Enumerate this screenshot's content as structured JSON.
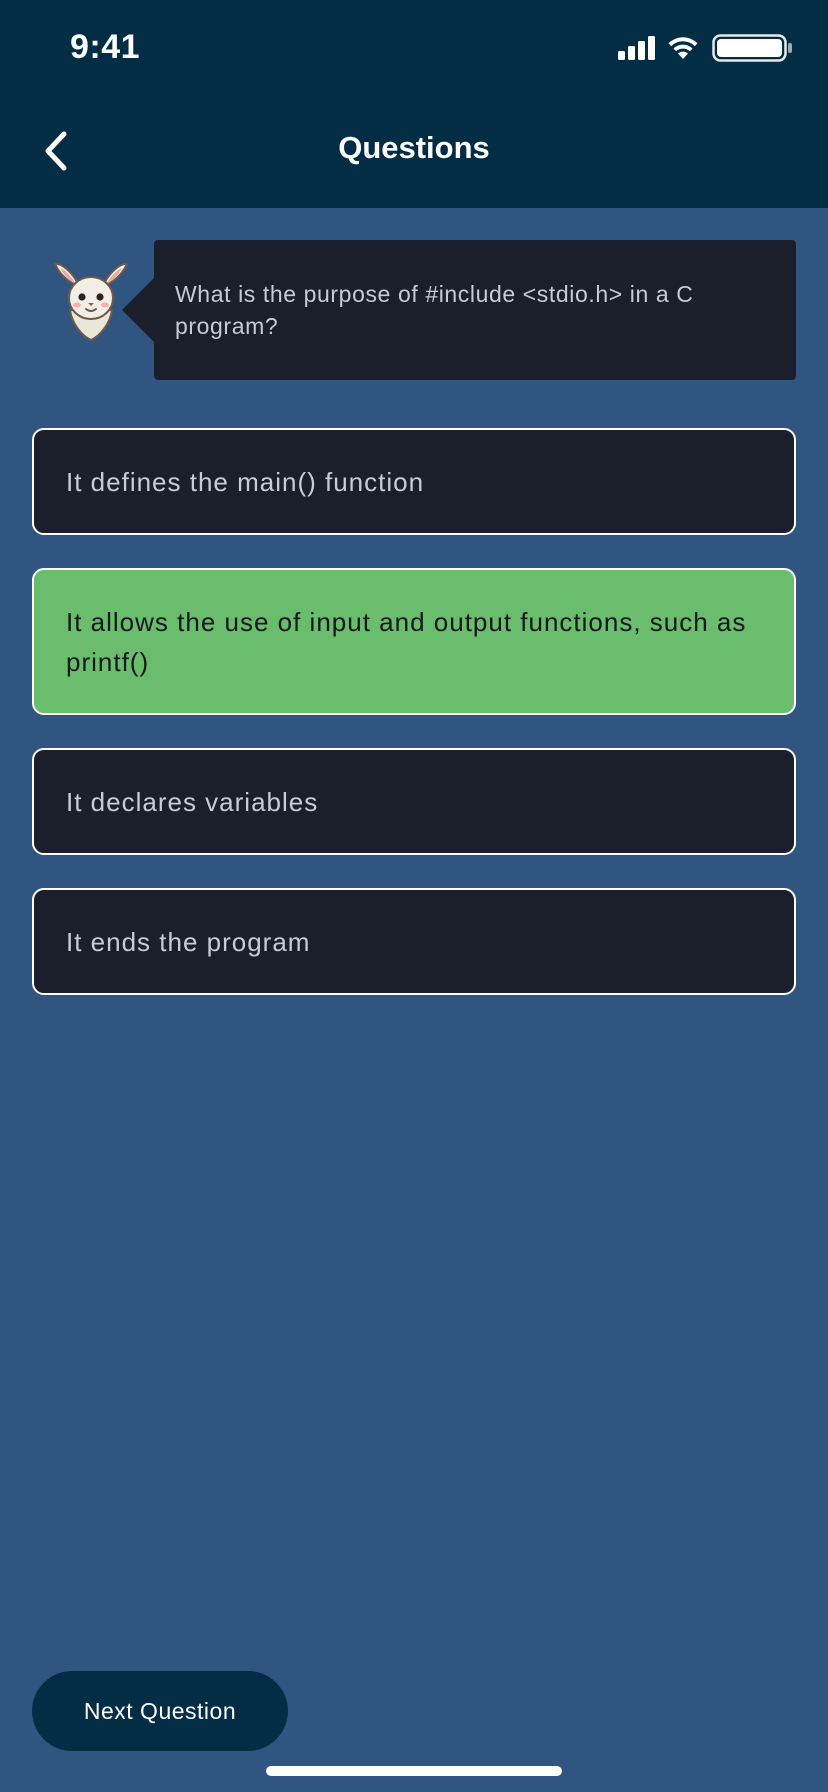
{
  "status_bar": {
    "time": "9:41",
    "icons": [
      "cellular-signal-icon",
      "wifi-icon",
      "battery-icon"
    ]
  },
  "header": {
    "title": "Questions",
    "back_icon": "chevron-left-icon"
  },
  "question": {
    "mascot_icon": "bunny-mascot-icon",
    "text": "What is the purpose of #include <stdio.h> in a C program?"
  },
  "answers": [
    {
      "label": "It defines the main() function",
      "selected": false
    },
    {
      "label": "It allows the use of input and output functions, such as printf()",
      "selected": true
    },
    {
      "label": "It declares variables",
      "selected": false
    },
    {
      "label": "It ends the program",
      "selected": false
    }
  ],
  "footer": {
    "next_label": "Next Question"
  },
  "colors": {
    "background": "#315581",
    "header": "#032d44",
    "card": "#1b1f2b",
    "correct": "#69bd6c"
  }
}
